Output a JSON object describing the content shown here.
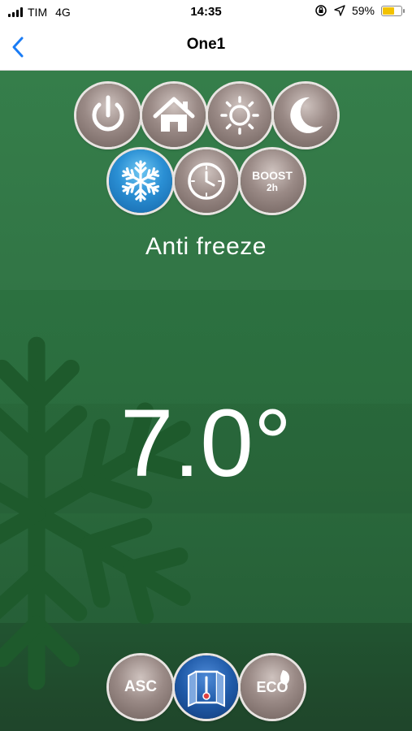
{
  "status_bar": {
    "carrier": "TIM",
    "network": "4G",
    "time": "14:35",
    "battery_percent": "59%",
    "battery_level": 0.59,
    "icons": [
      "signal-icon",
      "orientation-lock-icon",
      "location-arrow-icon",
      "battery-icon"
    ]
  },
  "nav": {
    "title": "One1",
    "back_icon": "chevron-left-icon"
  },
  "modes": [
    {
      "id": "off",
      "icon": "power-icon",
      "active": false
    },
    {
      "id": "comfort",
      "icon": "home-icon",
      "active": false
    },
    {
      "id": "day",
      "icon": "sun-icon",
      "active": false
    },
    {
      "id": "night",
      "icon": "moon-icon",
      "active": false
    },
    {
      "id": "antifreeze",
      "icon": "snowflake-icon",
      "active": true
    },
    {
      "id": "program",
      "icon": "clock-icon",
      "active": false
    },
    {
      "id": "boost",
      "icon": "boost-icon",
      "active": false
    }
  ],
  "boost": {
    "line1": "BOOST",
    "line2": "2h"
  },
  "current_mode_label": "Anti freeze",
  "temperature": "7.0°",
  "bottom_buttons": {
    "asc_label": "ASC",
    "window_icon": "open-window-icon",
    "eco_label": "ECO"
  },
  "colors": {
    "background_green": "#2a6a3c",
    "active_blue": "#2a8fd4",
    "ios_blue": "#1a7cf5",
    "battery_yellow": "#f2c200"
  }
}
